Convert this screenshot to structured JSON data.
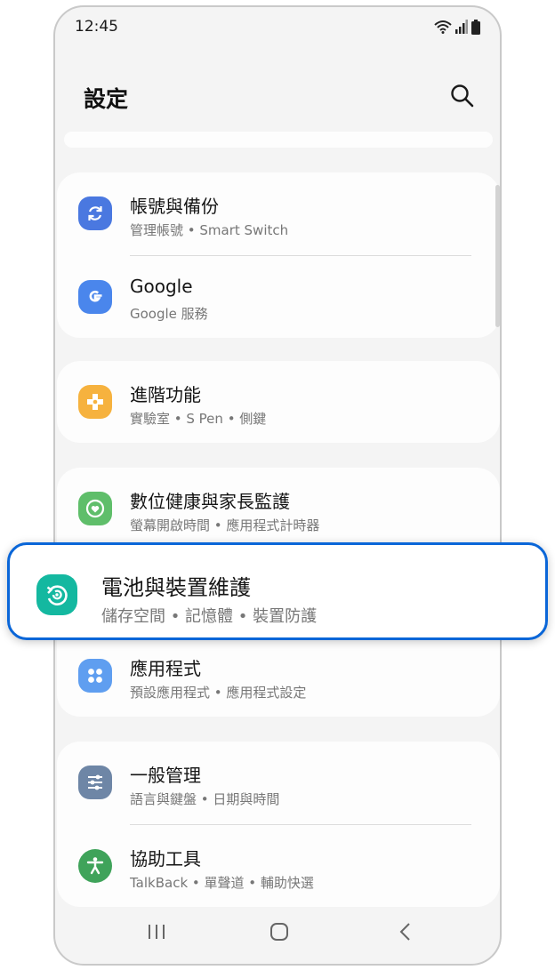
{
  "status_bar": {
    "time": "12:45",
    "icons": [
      "wifi-icon",
      "signal-icon",
      "battery-icon"
    ]
  },
  "header": {
    "title": "設定",
    "search_icon": "search-icon"
  },
  "cards": [
    {
      "items": [
        {
          "title": "帳號與備份",
          "subtitle": "管理帳號 • Smart Switch",
          "icon": "sync-icon",
          "color": "#4a78e0"
        },
        {
          "title": "Google",
          "subtitle": "Google 服務",
          "icon": "google-icon",
          "color": "#4a86ec"
        }
      ]
    },
    {
      "items": [
        {
          "title": "進階功能",
          "subtitle": "實驗室 • S Pen • 側鍵",
          "icon": "advanced-features-icon",
          "color": "#f6b23e"
        }
      ]
    },
    {
      "items": [
        {
          "title": "數位健康與家長監護",
          "subtitle": "螢幕開啟時間 • 應用程式計時器",
          "icon": "digital-wellbeing-icon",
          "color": "#5fbe6a"
        }
      ]
    },
    {
      "items": [
        {
          "title": "應用程式",
          "subtitle": "預設應用程式 • 應用程式設定",
          "icon": "apps-icon",
          "color": "#5f9ef0"
        }
      ]
    },
    {
      "items": [
        {
          "title": "一般管理",
          "subtitle": "語言與鍵盤 • 日期與時間",
          "icon": "sliders-icon",
          "color": "#6e86a6"
        },
        {
          "title": "協助工具",
          "subtitle": "TalkBack • 單聲道 • 輔助快選",
          "icon": "accessibility-icon",
          "color": "#3fa35a"
        }
      ]
    }
  ],
  "highlighted_item": {
    "title": "電池與裝置維護",
    "subtitle": "儲存空間 • 記憶體 • 裝置防護",
    "icon": "device-care-icon",
    "color": "#14b8a0",
    "border_color": "#0a66d8"
  },
  "nav_bar": {
    "buttons": [
      "recent-apps-icon",
      "home-icon",
      "back-icon"
    ]
  }
}
